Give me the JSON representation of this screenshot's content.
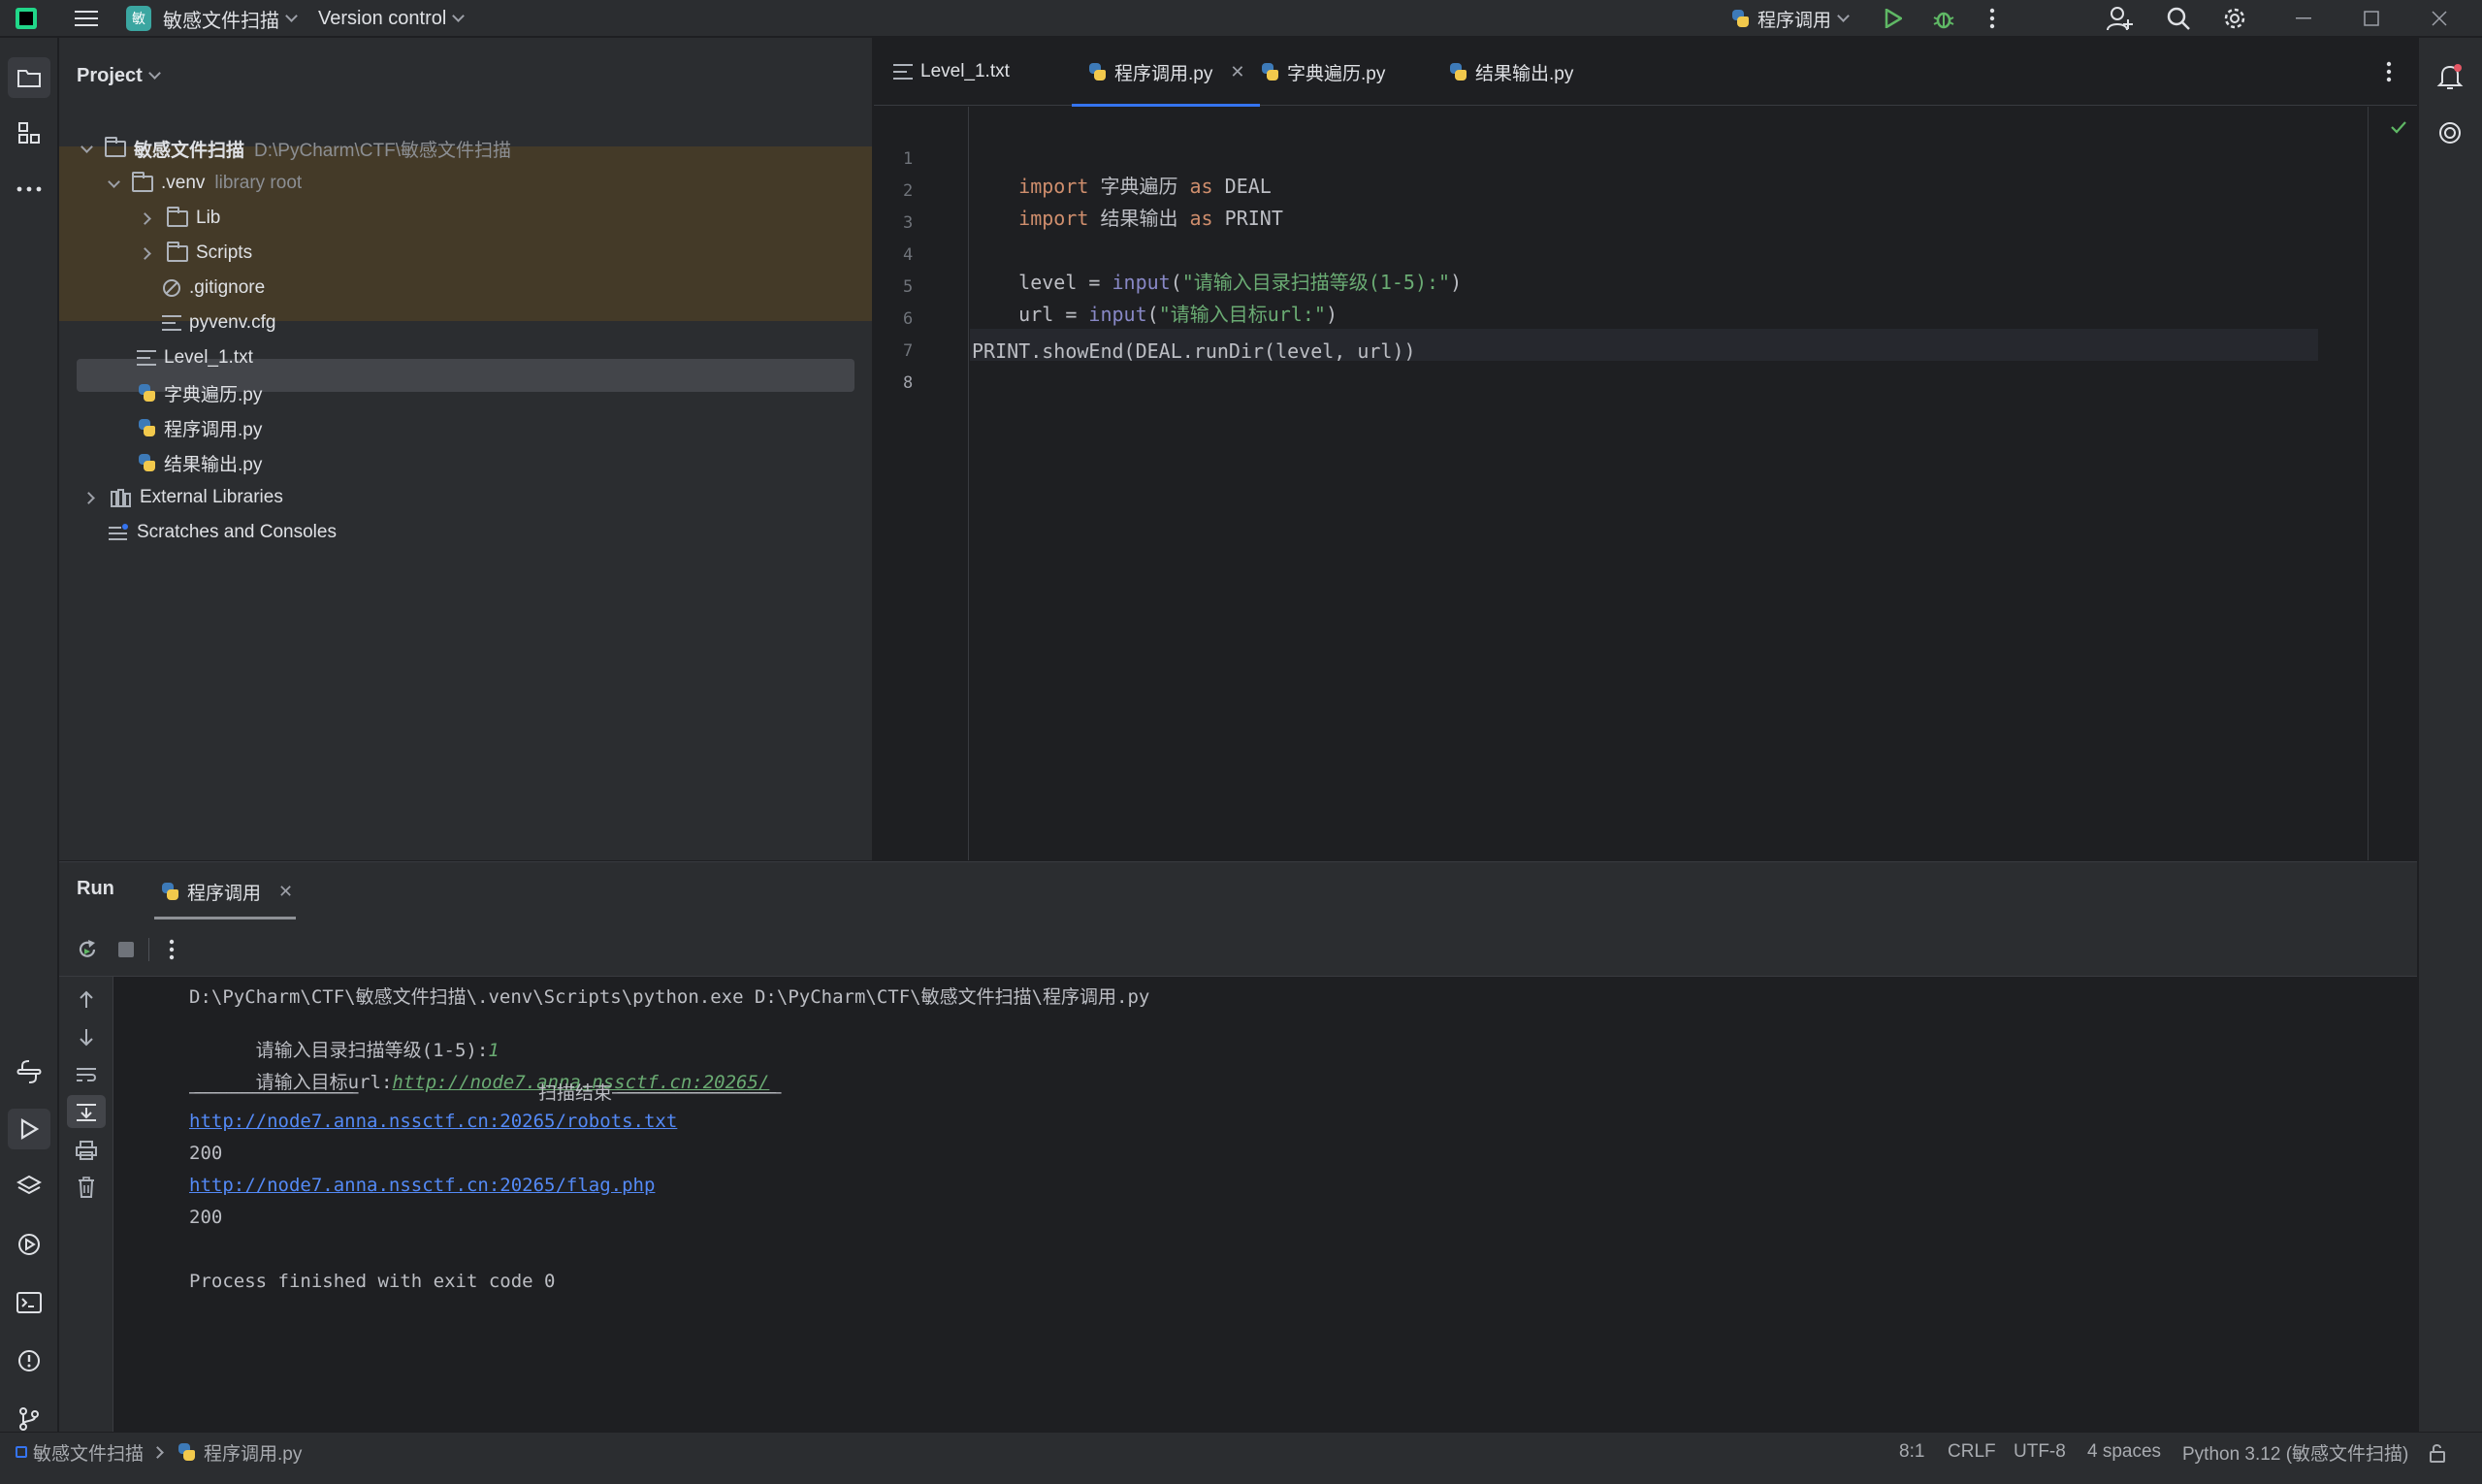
{
  "titlebar": {
    "project_badge": "敏",
    "project_name": "敏感文件扫描",
    "version_control": "Version control",
    "run_config": "程序调用"
  },
  "project_panel": {
    "title": "Project",
    "tree": [
      {
        "label": "敏感文件扫描",
        "hint": "D:\\PyCharm\\CTF\\敏感文件扫描"
      },
      {
        "label": ".venv",
        "hint": "library root"
      },
      {
        "label": "Lib"
      },
      {
        "label": "Scripts"
      },
      {
        "label": ".gitignore"
      },
      {
        "label": "pyvenv.cfg"
      },
      {
        "label": "Level_1.txt"
      },
      {
        "label": "字典遍历.py"
      },
      {
        "label": "程序调用.py"
      },
      {
        "label": "结果输出.py"
      },
      {
        "label": "External Libraries"
      },
      {
        "label": "Scratches and Consoles"
      }
    ]
  },
  "editor": {
    "tabs": [
      {
        "label": "Level_1.txt"
      },
      {
        "label": "程序调用.py"
      },
      {
        "label": "字典遍历.py"
      },
      {
        "label": "结果输出.py"
      }
    ],
    "line_numbers": [
      "1",
      "2",
      "3",
      "4",
      "5",
      "6",
      "7",
      "8"
    ],
    "code": {
      "l1_kw": "import",
      "l1_mod": " 字典遍历 ",
      "l1_as": "as",
      "l1_alias": " DEAL",
      "l2_kw": "import",
      "l2_mod": " 结果输出 ",
      "l2_as": "as",
      "l2_alias": " PRINT",
      "l4_var": "level = ",
      "l4_fn": "input",
      "l4_open": "(",
      "l4_str": "\"请输入目录扫描等级(1-5):\"",
      "l4_close": ")",
      "l5_var": "url = ",
      "l5_fn": "input",
      "l5_open": "(",
      "l5_str": "\"请输入目标url:\"",
      "l5_close": ")",
      "l7": "PRINT.showEnd(DEAL.runDir(level, url))"
    }
  },
  "run_panel": {
    "title": "Run",
    "tab_label": "程序调用",
    "output": {
      "cmd": "D:\\PyCharm\\CTF\\敏感文件扫描\\.venv\\Scripts\\python.exe D:\\PyCharm\\CTF\\敏感文件扫描\\程序调用.py",
      "prompt_level": "请输入目录扫描等级(1-5):",
      "level_value": "1",
      "prompt_url": "请输入目标url:",
      "url_value": "http://node7.anna.nssctf.cn:20265/",
      "separator_left": "———————————————————————————————",
      "separator_text": "扫描结束",
      "separator_right": "———————————————————————————————",
      "result1_url": "http://node7.anna.nssctf.cn:20265/robots.txt",
      "result1_code": "200",
      "result2_url": "http://node7.anna.nssctf.cn:20265/flag.php",
      "result2_code": "200",
      "exit": "Process finished with exit code 0"
    }
  },
  "statusbar": {
    "breadcrumb_project": "敏感文件扫描",
    "breadcrumb_file": "程序调用.py",
    "position": "8:1",
    "line_sep": "CRLF",
    "encoding": "UTF-8",
    "indent": "4 spaces",
    "interpreter": "Python 3.12 (敏感文件扫描)"
  },
  "colors": {
    "accent": "#3574f0",
    "keyword": "#cf8e6d",
    "string": "#6aab73",
    "link": "#548af7",
    "venv_highlight": "#4d3f26"
  }
}
